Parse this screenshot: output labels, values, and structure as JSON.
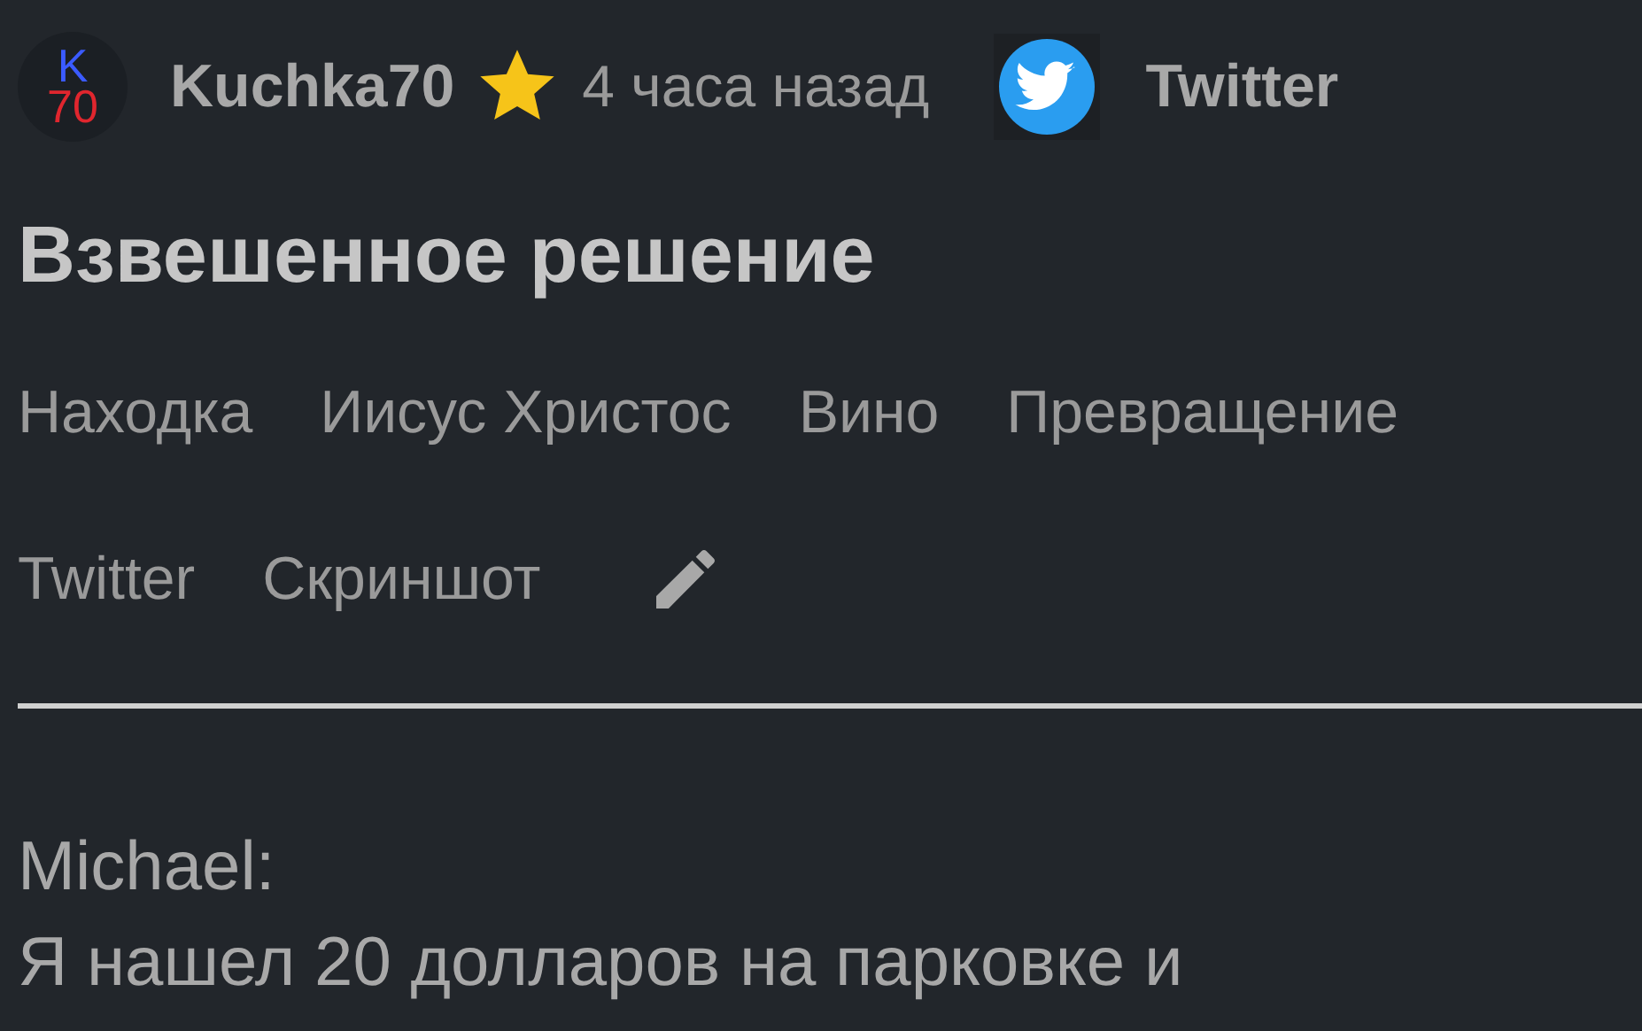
{
  "post": {
    "avatar": {
      "letter": "K",
      "number": "70"
    },
    "author": "Kuchka70",
    "time": "4 часа назад",
    "source": "Twitter"
  },
  "title": "Взвешенное решение",
  "tags": [
    "Находка",
    "Иисус Христос",
    "Вино",
    "Превращение",
    "Twitter",
    "Скриншот"
  ],
  "body": [
    "Michael:",
    "Я нашел 20 долларов на парковке и"
  ]
}
